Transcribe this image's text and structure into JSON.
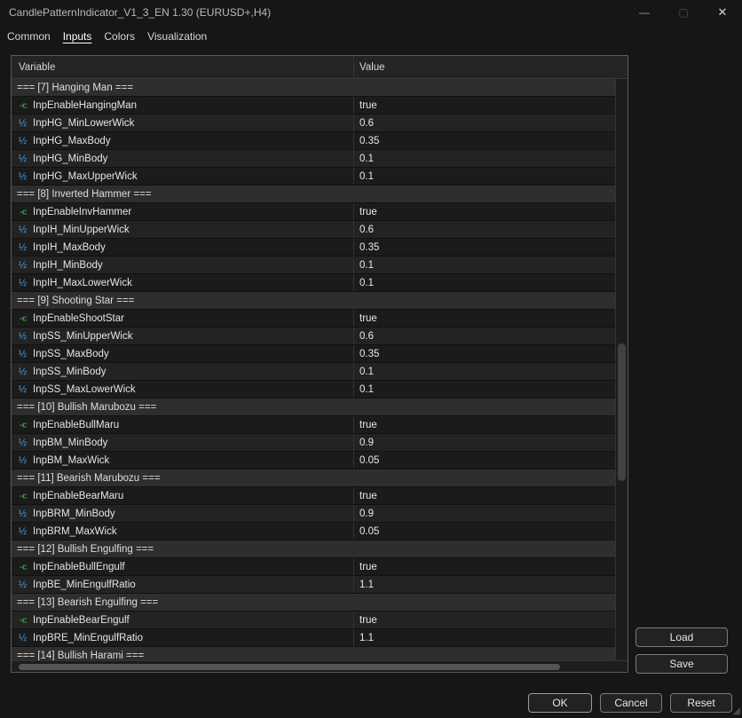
{
  "window": {
    "title": "CandlePatternIndicator_V1_3_EN 1.30 (EURUSD+,H4)",
    "controls": {
      "minimize": "—",
      "maximize": "▢",
      "close": "✕"
    }
  },
  "tabs": [
    {
      "label": "Common",
      "active": false
    },
    {
      "label": "Inputs",
      "active": true
    },
    {
      "label": "Colors",
      "active": false
    },
    {
      "label": "Visualization",
      "active": false
    }
  ],
  "icons": {
    "bool": "⑂",
    "double": "½",
    "resize_grip": "◢"
  },
  "colors": {
    "bool_icon": "#3fae46",
    "double_icon": "#4a9fe8"
  },
  "table": {
    "headers": [
      "Variable",
      "Value"
    ],
    "rows": [
      {
        "type": "group",
        "label": "=== [7] Hanging Man ==="
      },
      {
        "type": "bool",
        "name": "InpEnableHangingMan",
        "value": "true"
      },
      {
        "type": "double",
        "name": "InpHG_MinLowerWick",
        "value": "0.6"
      },
      {
        "type": "double",
        "name": "InpHG_MaxBody",
        "value": "0.35"
      },
      {
        "type": "double",
        "name": "InpHG_MinBody",
        "value": "0.1"
      },
      {
        "type": "double",
        "name": "InpHG_MaxUpperWick",
        "value": "0.1"
      },
      {
        "type": "group",
        "label": "=== [8] Inverted Hammer ==="
      },
      {
        "type": "bool",
        "name": "InpEnableInvHammer",
        "value": "true"
      },
      {
        "type": "double",
        "name": "InpIH_MinUpperWick",
        "value": "0.6"
      },
      {
        "type": "double",
        "name": "InpIH_MaxBody",
        "value": "0.35"
      },
      {
        "type": "double",
        "name": "InpIH_MinBody",
        "value": "0.1"
      },
      {
        "type": "double",
        "name": "InpIH_MaxLowerWick",
        "value": "0.1"
      },
      {
        "type": "group",
        "label": "=== [9] Shooting Star ==="
      },
      {
        "type": "bool",
        "name": "InpEnableShootStar",
        "value": "true"
      },
      {
        "type": "double",
        "name": "InpSS_MinUpperWick",
        "value": "0.6"
      },
      {
        "type": "double",
        "name": "InpSS_MaxBody",
        "value": "0.35"
      },
      {
        "type": "double",
        "name": "InpSS_MinBody",
        "value": "0.1"
      },
      {
        "type": "double",
        "name": "InpSS_MaxLowerWick",
        "value": "0.1"
      },
      {
        "type": "group",
        "label": "=== [10] Bullish Marubozu ==="
      },
      {
        "type": "bool",
        "name": "InpEnableBullMaru",
        "value": "true"
      },
      {
        "type": "double",
        "name": "InpBM_MinBody",
        "value": "0.9"
      },
      {
        "type": "double",
        "name": "InpBM_MaxWick",
        "value": "0.05"
      },
      {
        "type": "group",
        "label": "=== [11] Bearish Marubozu ==="
      },
      {
        "type": "bool",
        "name": "InpEnableBearMaru",
        "value": "true"
      },
      {
        "type": "double",
        "name": "InpBRM_MinBody",
        "value": "0.9"
      },
      {
        "type": "double",
        "name": "InpBRM_MaxWick",
        "value": "0.05"
      },
      {
        "type": "group",
        "label": "=== [12] Bullish Engulfing ==="
      },
      {
        "type": "bool",
        "name": "InpEnableBullEngulf",
        "value": "true"
      },
      {
        "type": "double",
        "name": "InpBE_MinEngulfRatio",
        "value": "1.1"
      },
      {
        "type": "group",
        "label": "=== [13] Bearish Engulfing ==="
      },
      {
        "type": "bool",
        "name": "InpEnableBearEngulf",
        "value": "true"
      },
      {
        "type": "double",
        "name": "InpBRE_MinEngulfRatio",
        "value": "1.1"
      },
      {
        "type": "group",
        "label": "=== [14] Bullish Harami ==="
      }
    ]
  },
  "buttons": {
    "load": "Load",
    "save": "Save",
    "ok": "OK",
    "cancel": "Cancel",
    "reset": "Reset"
  }
}
